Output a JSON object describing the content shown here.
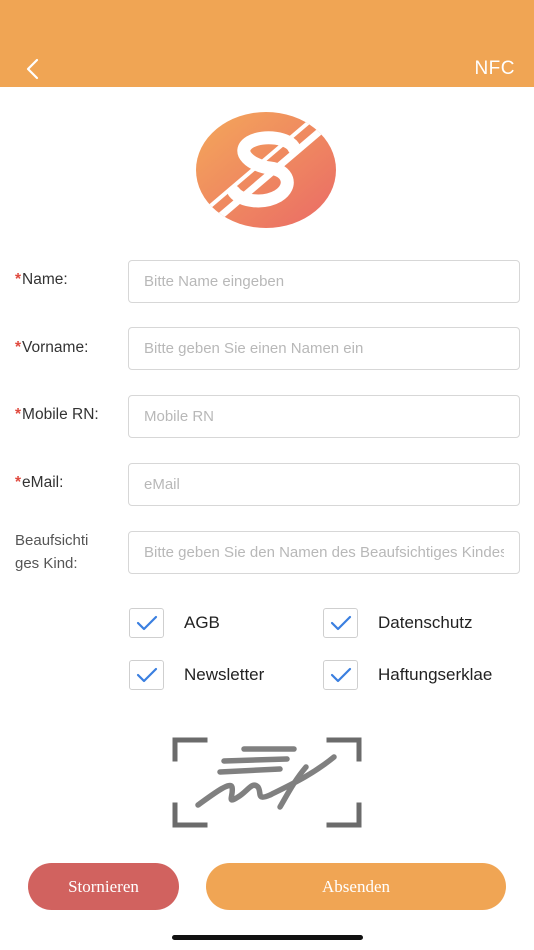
{
  "header": {
    "background": "#f0a554",
    "back_icon": "chevron-left-icon",
    "nfc_label": "NFC"
  },
  "logo": {
    "icon": "s-brand-logo"
  },
  "form": {
    "name": {
      "required_mark": "*",
      "label": "Name:",
      "placeholder": "Bitte Name eingeben",
      "value": ""
    },
    "vorname": {
      "required_mark": "*",
      "label": "Vorname:",
      "placeholder": "Bitte geben Sie einen Namen ein",
      "value": ""
    },
    "mobile": {
      "required_mark": "*",
      "label": "Mobile RN:",
      "placeholder": "Mobile RN",
      "value": ""
    },
    "email": {
      "required_mark": "*",
      "label": "eMail:",
      "placeholder": "eMail",
      "value": ""
    },
    "kind": {
      "label_line1": "Beaufsichti",
      "label_line2": "ges Kind:",
      "placeholder": "Bitte geben Sie den Namen des Beaufsichtiges Kindes ein",
      "value": ""
    }
  },
  "checkboxes": {
    "agb": {
      "label": "AGB",
      "checked": true
    },
    "datenschutz": {
      "label": "Datenschutz",
      "checked": true
    },
    "newsletter": {
      "label": "Newsletter",
      "checked": true
    },
    "haftung": {
      "label": "Haftungserklae",
      "checked": true
    }
  },
  "signature": {
    "icon": "signature-icon"
  },
  "buttons": {
    "cancel_label": "Stornieren",
    "submit_label": "Absenden",
    "cancel_color": "#d1625f",
    "submit_color": "#f0a554"
  },
  "colors": {
    "accent": "#f0a554",
    "required": "#e04a3f",
    "check": "#3a7fe0"
  }
}
